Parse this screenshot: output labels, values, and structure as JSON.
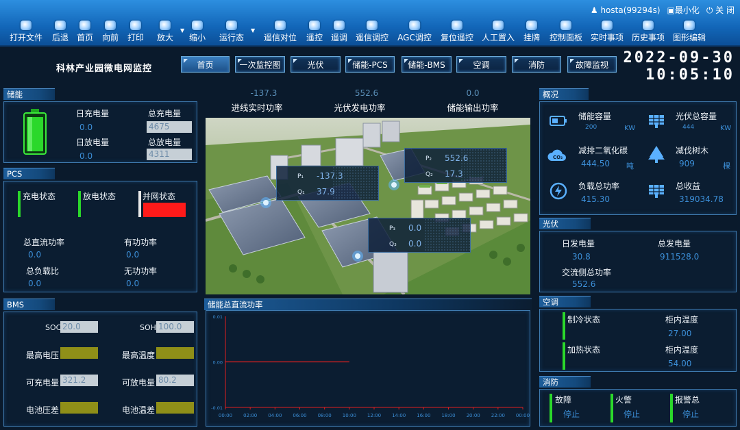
{
  "user": {
    "name": "hosta(99294s)",
    "minimize": "最小化",
    "close": "关 闭"
  },
  "toolbar": [
    {
      "label": "打开文件",
      "icon": "open-file-icon"
    },
    {
      "label": "后退",
      "icon": "back-icon"
    },
    {
      "label": "首页",
      "icon": "home-icon"
    },
    {
      "label": "向前",
      "icon": "forward-icon"
    },
    {
      "label": "打印",
      "icon": "print-icon"
    },
    {
      "label": "放大",
      "icon": "zoom-in-icon"
    },
    {
      "label": "缩小",
      "icon": "zoom-out-icon"
    },
    {
      "label": "运行态",
      "icon": "run-state-icon"
    },
    {
      "label": "遥信对位",
      "icon": "telesignal-align-icon"
    },
    {
      "label": "遥控",
      "icon": "remote-control-icon"
    },
    {
      "label": "遥调",
      "icon": "remote-adjust-icon"
    },
    {
      "label": "遥信调控",
      "icon": "telesignal-control-icon"
    },
    {
      "label": "AGC调控",
      "icon": "agc-icon"
    },
    {
      "label": "复位遥控",
      "icon": "reset-control-icon"
    },
    {
      "label": "人工置入",
      "icon": "manual-input-icon"
    },
    {
      "label": "挂牌",
      "icon": "tag-icon"
    },
    {
      "label": "控制面板",
      "icon": "control-panel-icon"
    },
    {
      "label": "实时事项",
      "icon": "realtime-events-icon"
    },
    {
      "label": "历史事项",
      "icon": "history-events-icon"
    },
    {
      "label": "图形编辑",
      "icon": "graph-edit-icon"
    }
  ],
  "header": {
    "station": "科林产业园微电网监控",
    "nav": [
      "首页",
      "一次监控图",
      "光伏",
      "储能-PCS",
      "储能-BMS",
      "空调",
      "消防",
      "故障监视"
    ],
    "active_nav": "首页",
    "date": "2022-09-30",
    "time": "10:05:10"
  },
  "storage": {
    "title": "储能",
    "daily_charge_label": "日充电量",
    "daily_charge": "0.0",
    "total_charge_label": "总充电量",
    "total_charge": "4675",
    "daily_discharge_label": "日放电量",
    "daily_discharge": "0.0",
    "total_discharge_label": "总放电量",
    "total_discharge": "4311",
    "battery_color": "#2bd82b"
  },
  "pcs": {
    "title": "PCS",
    "charge_state": "充电状态",
    "discharge_state": "放电状态",
    "grid_state": "并网状态",
    "grid_state_color": "#ff1a1a",
    "state_bar_color": "#2bd82b",
    "dc_power_label": "总直流功率",
    "dc_power": "0.0",
    "active_power_label": "有功功率",
    "active_power": "0.0",
    "load_ratio_label": "总负载比",
    "load_ratio": "0.0",
    "reactive_power_label": "无功功率",
    "reactive_power": "0.0"
  },
  "bms": {
    "title": "BMS",
    "soc_label": "SOC",
    "soc": "20.0",
    "soh_label": "SOH",
    "soh": "100.0",
    "max_voltage_label": "最高电压",
    "max_temp_label": "最高温度",
    "chargeable_label": "可充电量",
    "chargeable": "321.2",
    "dischargeable_label": "可放电量",
    "dischargeable": "80.2",
    "volt_diff_label": "电池压差",
    "temp_diff_label": "电池温差"
  },
  "center": {
    "metrics": [
      {
        "label": "进线实时功率",
        "value": "-137.3"
      },
      {
        "label": "光伏发电功率",
        "value": "552.6"
      },
      {
        "label": "储能输出功率",
        "value": "0.0"
      }
    ],
    "overlays": [
      {
        "p_label": "P₁",
        "p": "-137.3",
        "q_label": "Q₁",
        "q": "37.9"
      },
      {
        "p_label": "P₂",
        "p": "552.6",
        "q_label": "Q₂",
        "q": "17.3"
      },
      {
        "p_label": "P₃",
        "p": "0.0",
        "q_label": "Q₃",
        "q": "0.0"
      }
    ]
  },
  "chart_title": "储能总直流功率",
  "chart_data": {
    "type": "line",
    "title": "储能总直流功率",
    "x": [
      "00:00",
      "02:00",
      "04:00",
      "06:00",
      "08:00",
      "10:00",
      "12:00",
      "14:00",
      "16:00",
      "18:00",
      "20:00",
      "22:00",
      "00:00"
    ],
    "ytick_labels": [
      "0.01",
      "0.00",
      "-0.01"
    ],
    "ylim": [
      -0.01,
      0.01
    ],
    "series": [
      {
        "values": [
          0,
          0,
          0,
          0,
          0,
          0
        ]
      }
    ],
    "series_x_hours": [
      0,
      2,
      4,
      6,
      8,
      10
    ],
    "line_color": "#e02020",
    "axis_color": "#e02020",
    "tick_color": "#3c8fd8"
  },
  "overview": {
    "title": "概况",
    "storage_capacity_label": "储能容量",
    "storage_capacity": "200",
    "storage_capacity_unit": "KW",
    "pv_capacity_label": "光伏总容量",
    "pv_capacity": "444",
    "pv_capacity_unit": "KW",
    "co2_label": "减排二氧化碳",
    "co2": "444.50",
    "co2_unit": "吨",
    "trees_label": "减伐树木",
    "trees": "909",
    "trees_unit": "棵",
    "load_power_label": "负载总功率",
    "load_power": "415.30",
    "total_income_label": "总收益",
    "total_income": "319034.78"
  },
  "pv": {
    "title": "光伏",
    "daily_gen_label": "日发电量",
    "daily_gen": "30.8",
    "total_gen_label": "总发电量",
    "total_gen": "911528.0",
    "ac_power_label": "交流侧总功率",
    "ac_power": "552.6"
  },
  "ac": {
    "title": "空调",
    "cooling_label": "制冷状态",
    "heating_label": "加热状态",
    "temp1_label": "柜内温度",
    "temp1": "27.00",
    "temp2_label": "柜内温度",
    "temp2": "54.00"
  },
  "fire": {
    "title": "消防",
    "fault_label": "故障",
    "fault": "停止",
    "fire_label": "火警",
    "fire": "停止",
    "alarm_label": "报警总",
    "alarm": "停止"
  }
}
